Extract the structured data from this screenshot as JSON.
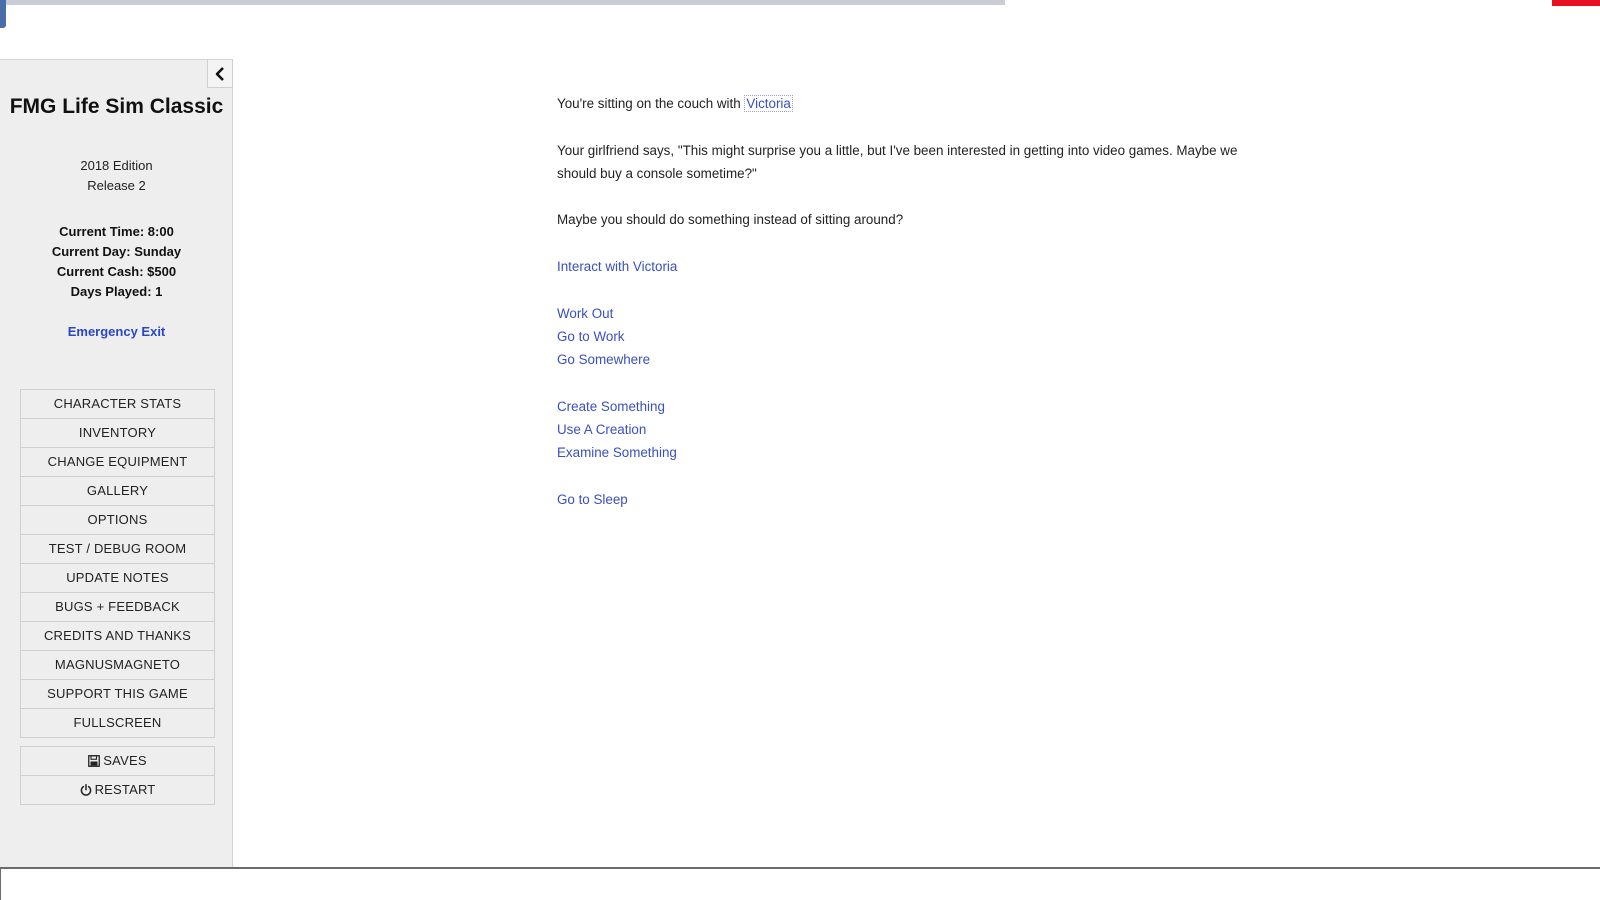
{
  "sidebar": {
    "title": "FMG Life Sim Classic",
    "subtitle_line1": "2018 Edition",
    "subtitle_line2": "Release 2",
    "status": {
      "time": "Current Time: 8:00",
      "day": "Current Day: Sunday",
      "cash": "Current Cash: $500",
      "days_played": "Days Played: 1"
    },
    "emergency_exit": "Emergency Exit",
    "menu": [
      "CHARACTER STATS",
      "INVENTORY",
      "CHANGE EQUIPMENT",
      "GALLERY",
      "OPTIONS",
      "TEST / DEBUG ROOM",
      "UPDATE NOTES",
      "BUGS + FEEDBACK",
      "CREDITS AND THANKS",
      "MAGNUSMAGNETO",
      "SUPPORT THIS GAME",
      "FULLSCREEN"
    ],
    "saves_label": "SAVES",
    "restart_label": "RESTART"
  },
  "passage": {
    "line1_prefix": "You're sitting on the couch with ",
    "line1_link": "Victoria",
    "line2": "Your girlfriend says, \"This might surprise you a little, but I've been interested in getting into video games. Maybe we should buy a console sometime?\"",
    "line3": "Maybe you should do something instead of sitting around?",
    "interact_link": "Interact with Victoria",
    "actions_group1": [
      "Work Out",
      "Go to Work",
      "Go Somewhere"
    ],
    "actions_group2": [
      "Create Something",
      "Use A Creation",
      "Examine Something"
    ],
    "sleep_link": "Go to Sleep"
  },
  "icons": {
    "toggle": "chevron-left-icon",
    "saves": "floppy-disk-icon",
    "restart": "power-icon"
  },
  "colors": {
    "link": "#3a4fc0",
    "emergency": "#2b47c4",
    "sidebar_bg": "#eeeeee"
  }
}
